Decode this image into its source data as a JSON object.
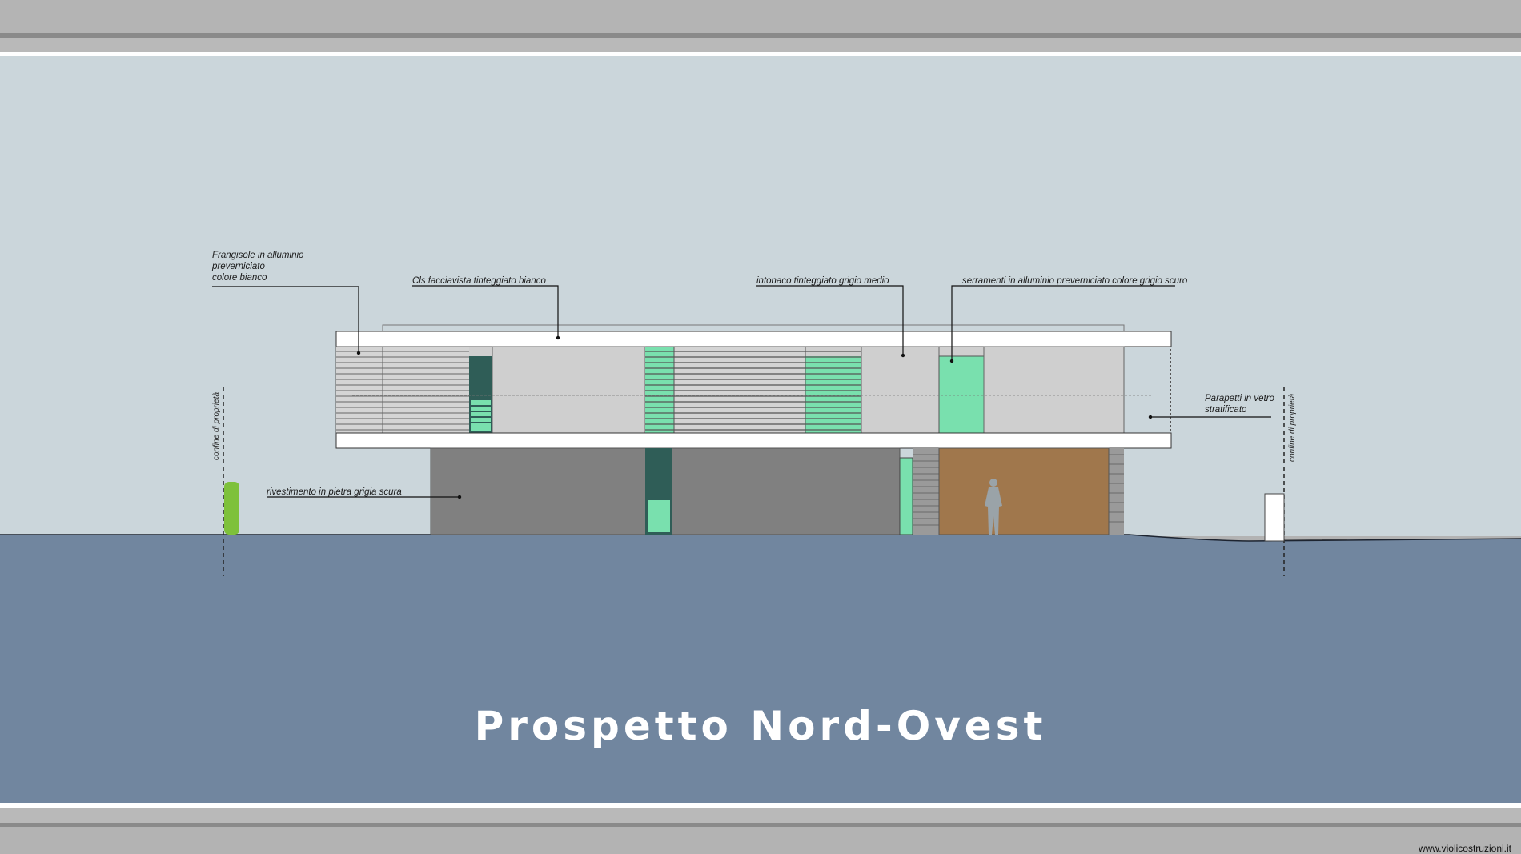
{
  "title": "Prospetto Nord-Ovest",
  "annotations": {
    "frangisole": "Frangisole in alluminio\npreverniciato\ncolore bianco",
    "cls": "Cls facciavista tinteggiato bianco",
    "intonaco": "intonaco tinteggiato grigio medio",
    "serramenti": "serramenti in alluminio preverniciato colore grigio scuro",
    "parapetti": "Parapetti in vetro\nstratificato",
    "rivestimento": "rivestimento in pietra grigia scura",
    "confine_left": "confine di proprietà",
    "confine_right": "confine di proprietà"
  },
  "watermark": "www.violicostruzioni.it",
  "colors": {
    "sky": "#cbd6db",
    "ground": "#71869f",
    "slab": "#ffffff",
    "render_grey": "#cfcfcf",
    "stone_dark": "#808080",
    "glass_green": "#79e0ae",
    "wood": "#a0774c",
    "hedge": "#7ec13b"
  }
}
